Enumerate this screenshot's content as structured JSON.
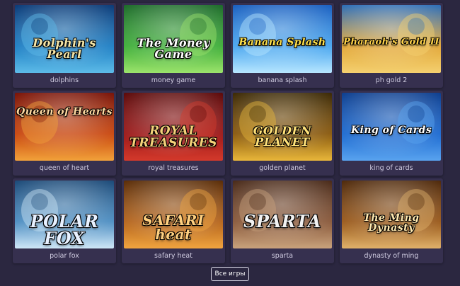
{
  "games": [
    {
      "caption": "dolphins",
      "title": "Dolphin's Pearl",
      "colors": [
        "#0b3b78",
        "#1f7fc4",
        "#5dbbe8"
      ],
      "icon": "dolphin-icon"
    },
    {
      "caption": "money game",
      "title": "The Money Game",
      "colors": [
        "#1d6b2a",
        "#3fae3a",
        "#9be36b"
      ],
      "icon": "businessman-icon"
    },
    {
      "caption": "banana splash",
      "title": "Banana Splash",
      "colors": [
        "#1a5fc0",
        "#49a6ef",
        "#b7e6ff"
      ],
      "icon": "banana-icon"
    },
    {
      "caption": "ph gold 2",
      "title": "Pharaoh's Gold II",
      "colors": [
        "#2c6db8",
        "#e2a83a",
        "#f4d06f"
      ],
      "icon": "pharaoh-icon"
    },
    {
      "caption": "queen of heart",
      "title": "Queen of Hearts",
      "colors": [
        "#7a1408",
        "#c9470f",
        "#f2a23a"
      ],
      "icon": "queen-icon"
    },
    {
      "caption": "royal treasures",
      "title": "ROYAL TREASURES",
      "colors": [
        "#5c0a0a",
        "#9d1a1a",
        "#d4392b"
      ],
      "icon": "crown-icon"
    },
    {
      "caption": "golden planet",
      "title": "GOLDEN PLANET",
      "colors": [
        "#3c2a06",
        "#8a5a0f",
        "#e9b73a"
      ],
      "icon": "planet-icon"
    },
    {
      "caption": "king of cards",
      "title": "King of Cards",
      "colors": [
        "#0e3f8f",
        "#1e6bd1",
        "#59a3ef"
      ],
      "icon": "joker-icon"
    },
    {
      "caption": "polar fox",
      "title": "POLAR FOX",
      "colors": [
        "#1c4a78",
        "#4d8ec2",
        "#cfe7f7"
      ],
      "icon": "fox-icon"
    },
    {
      "caption": "safary heat",
      "title": "SAFARI heat",
      "colors": [
        "#5a2d08",
        "#b5651d",
        "#f0a43f"
      ],
      "icon": "buffalo-icon"
    },
    {
      "caption": "sparta",
      "title": "SPARTA",
      "colors": [
        "#4a2b1a",
        "#8a5a3c",
        "#c9a27c"
      ],
      "icon": "spartan-icon"
    },
    {
      "caption": "dynasty of ming",
      "title": "The Ming Dynasty",
      "colors": [
        "#4f2a0c",
        "#9a5a1c",
        "#e0b16a"
      ],
      "icon": "warrior-icon"
    }
  ],
  "all_games_button": "Все игры"
}
